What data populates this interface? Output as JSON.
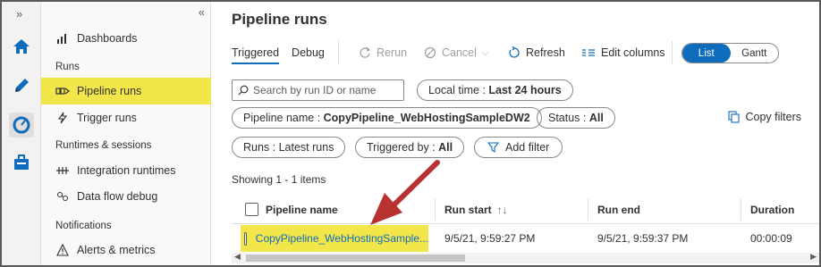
{
  "rail": {
    "expand_glyph": "»",
    "icons": [
      "home-icon",
      "pencil-icon",
      "monitor-icon",
      "toolbox-icon"
    ]
  },
  "nav": {
    "collapse_glyph": "«",
    "items": [
      {
        "label": "Dashboards",
        "icon": "dashboard-icon"
      },
      {
        "label": "Pipeline runs",
        "icon": "pipeline-icon"
      },
      {
        "label": "Trigger runs",
        "icon": "trigger-icon"
      },
      {
        "label": "Integration runtimes",
        "icon": "runtime-icon"
      },
      {
        "label": "Data flow debug",
        "icon": "dataflow-icon"
      },
      {
        "label": "Alerts & metrics",
        "icon": "alert-icon"
      }
    ],
    "sections": [
      "Runs",
      "Runtimes & sessions",
      "Notifications"
    ]
  },
  "main": {
    "title": "Pipeline runs",
    "tabs": [
      {
        "label": "Triggered"
      },
      {
        "label": "Debug"
      }
    ],
    "toolbar": {
      "rerun": "Rerun",
      "cancel": "Cancel",
      "refresh": "Refresh",
      "edit_columns": "Edit columns"
    },
    "view_toggle": {
      "list": "List",
      "gantt": "Gantt"
    },
    "search_placeholder": "Search by run ID or name",
    "filters": {
      "time_label": "Local time : ",
      "time_value": "Last 24 hours",
      "pipeline_label": "Pipeline name : ",
      "pipeline_value": "CopyPipeline_WebHostingSampleDW2",
      "status_label": "Status : ",
      "status_value": "All",
      "runs_label": "Runs : Latest runs",
      "triggered_label": "Triggered by : ",
      "triggered_value": "All",
      "add_filter": "Add filter",
      "copy_filters": "Copy filters"
    },
    "showing": "Showing 1 - 1 items",
    "columns": [
      "Pipeline name",
      "Run start",
      "Run end",
      "Duration"
    ],
    "rows": [
      {
        "pipeline": "CopyPipeline_WebHostingSample...",
        "run_start": "9/5/21, 9:59:27 PM",
        "run_end": "9/5/21, 9:59:37 PM",
        "duration": "00:00:09"
      }
    ]
  },
  "colors": {
    "accent": "#0f6cbd",
    "highlight": "#f2e64a",
    "arrow": "#b83232"
  }
}
